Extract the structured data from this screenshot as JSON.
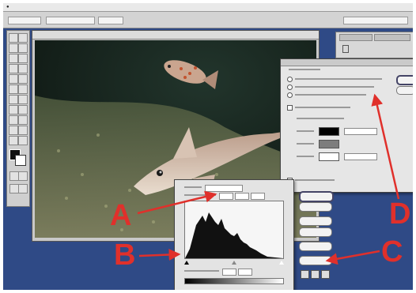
{
  "callouts": {
    "a": "A",
    "b": "B",
    "c": "C",
    "d": "D"
  },
  "colors": {
    "callout_red": "#e0302b",
    "desktop_blue": "#2f4a86"
  },
  "icons": [
    "apple-menu-icon",
    "tool-icons",
    "histogram",
    "eyedropper-icons"
  ]
}
